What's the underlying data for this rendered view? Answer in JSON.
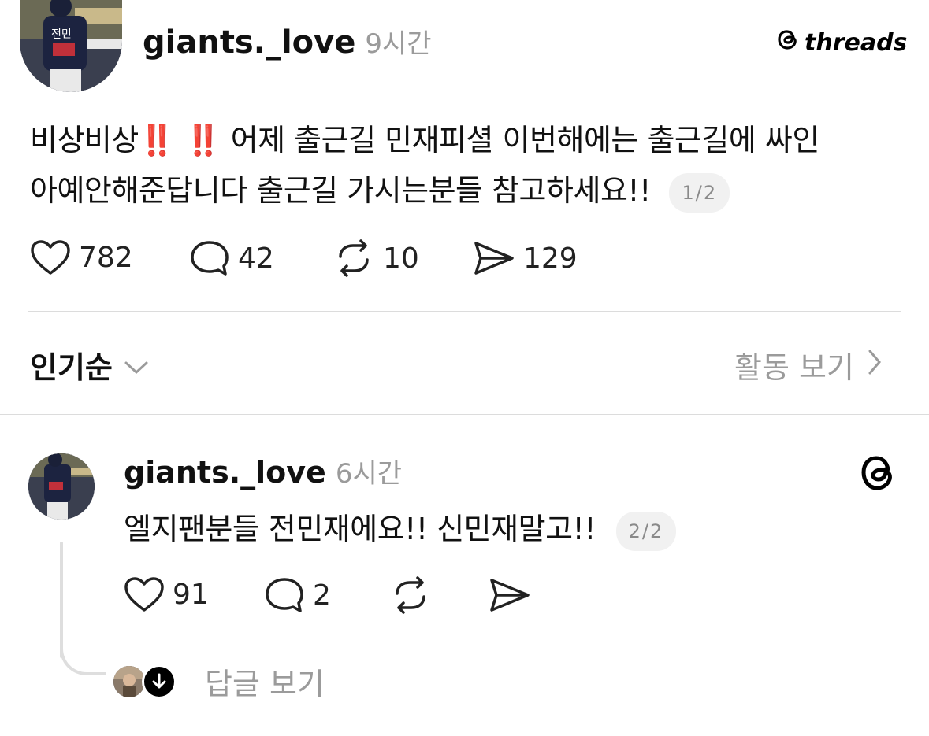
{
  "post": {
    "username": "giants._love",
    "time": "9시간",
    "brand": "threads",
    "text_line1": "비상비상",
    "emoji1": "‼️",
    "emoji2": "‼️",
    "text_line1_rest": "어제 출근길 민재피셜 이번해에는 출근길에 싸인",
    "text_line2": "아예안해준답니다 출근길 가시는분들 참고하세요!!",
    "pager": "1/2",
    "likes": "782",
    "comments": "42",
    "reposts": "10",
    "shares": "129"
  },
  "sort": {
    "label": "인기순",
    "activity": "활동 보기"
  },
  "reply": {
    "username": "giants._love",
    "time": "6시간",
    "text": "엘지팬분들 전민재에요!! 신민재말고!!",
    "pager": "2/2",
    "likes": "91",
    "comments": "2",
    "view_replies": "답글 보기"
  },
  "icons": {
    "heart": "heart-icon",
    "comment": "comment-icon",
    "repost": "repost-icon",
    "share": "share-icon",
    "threads_logo": "threads-logo-icon"
  }
}
